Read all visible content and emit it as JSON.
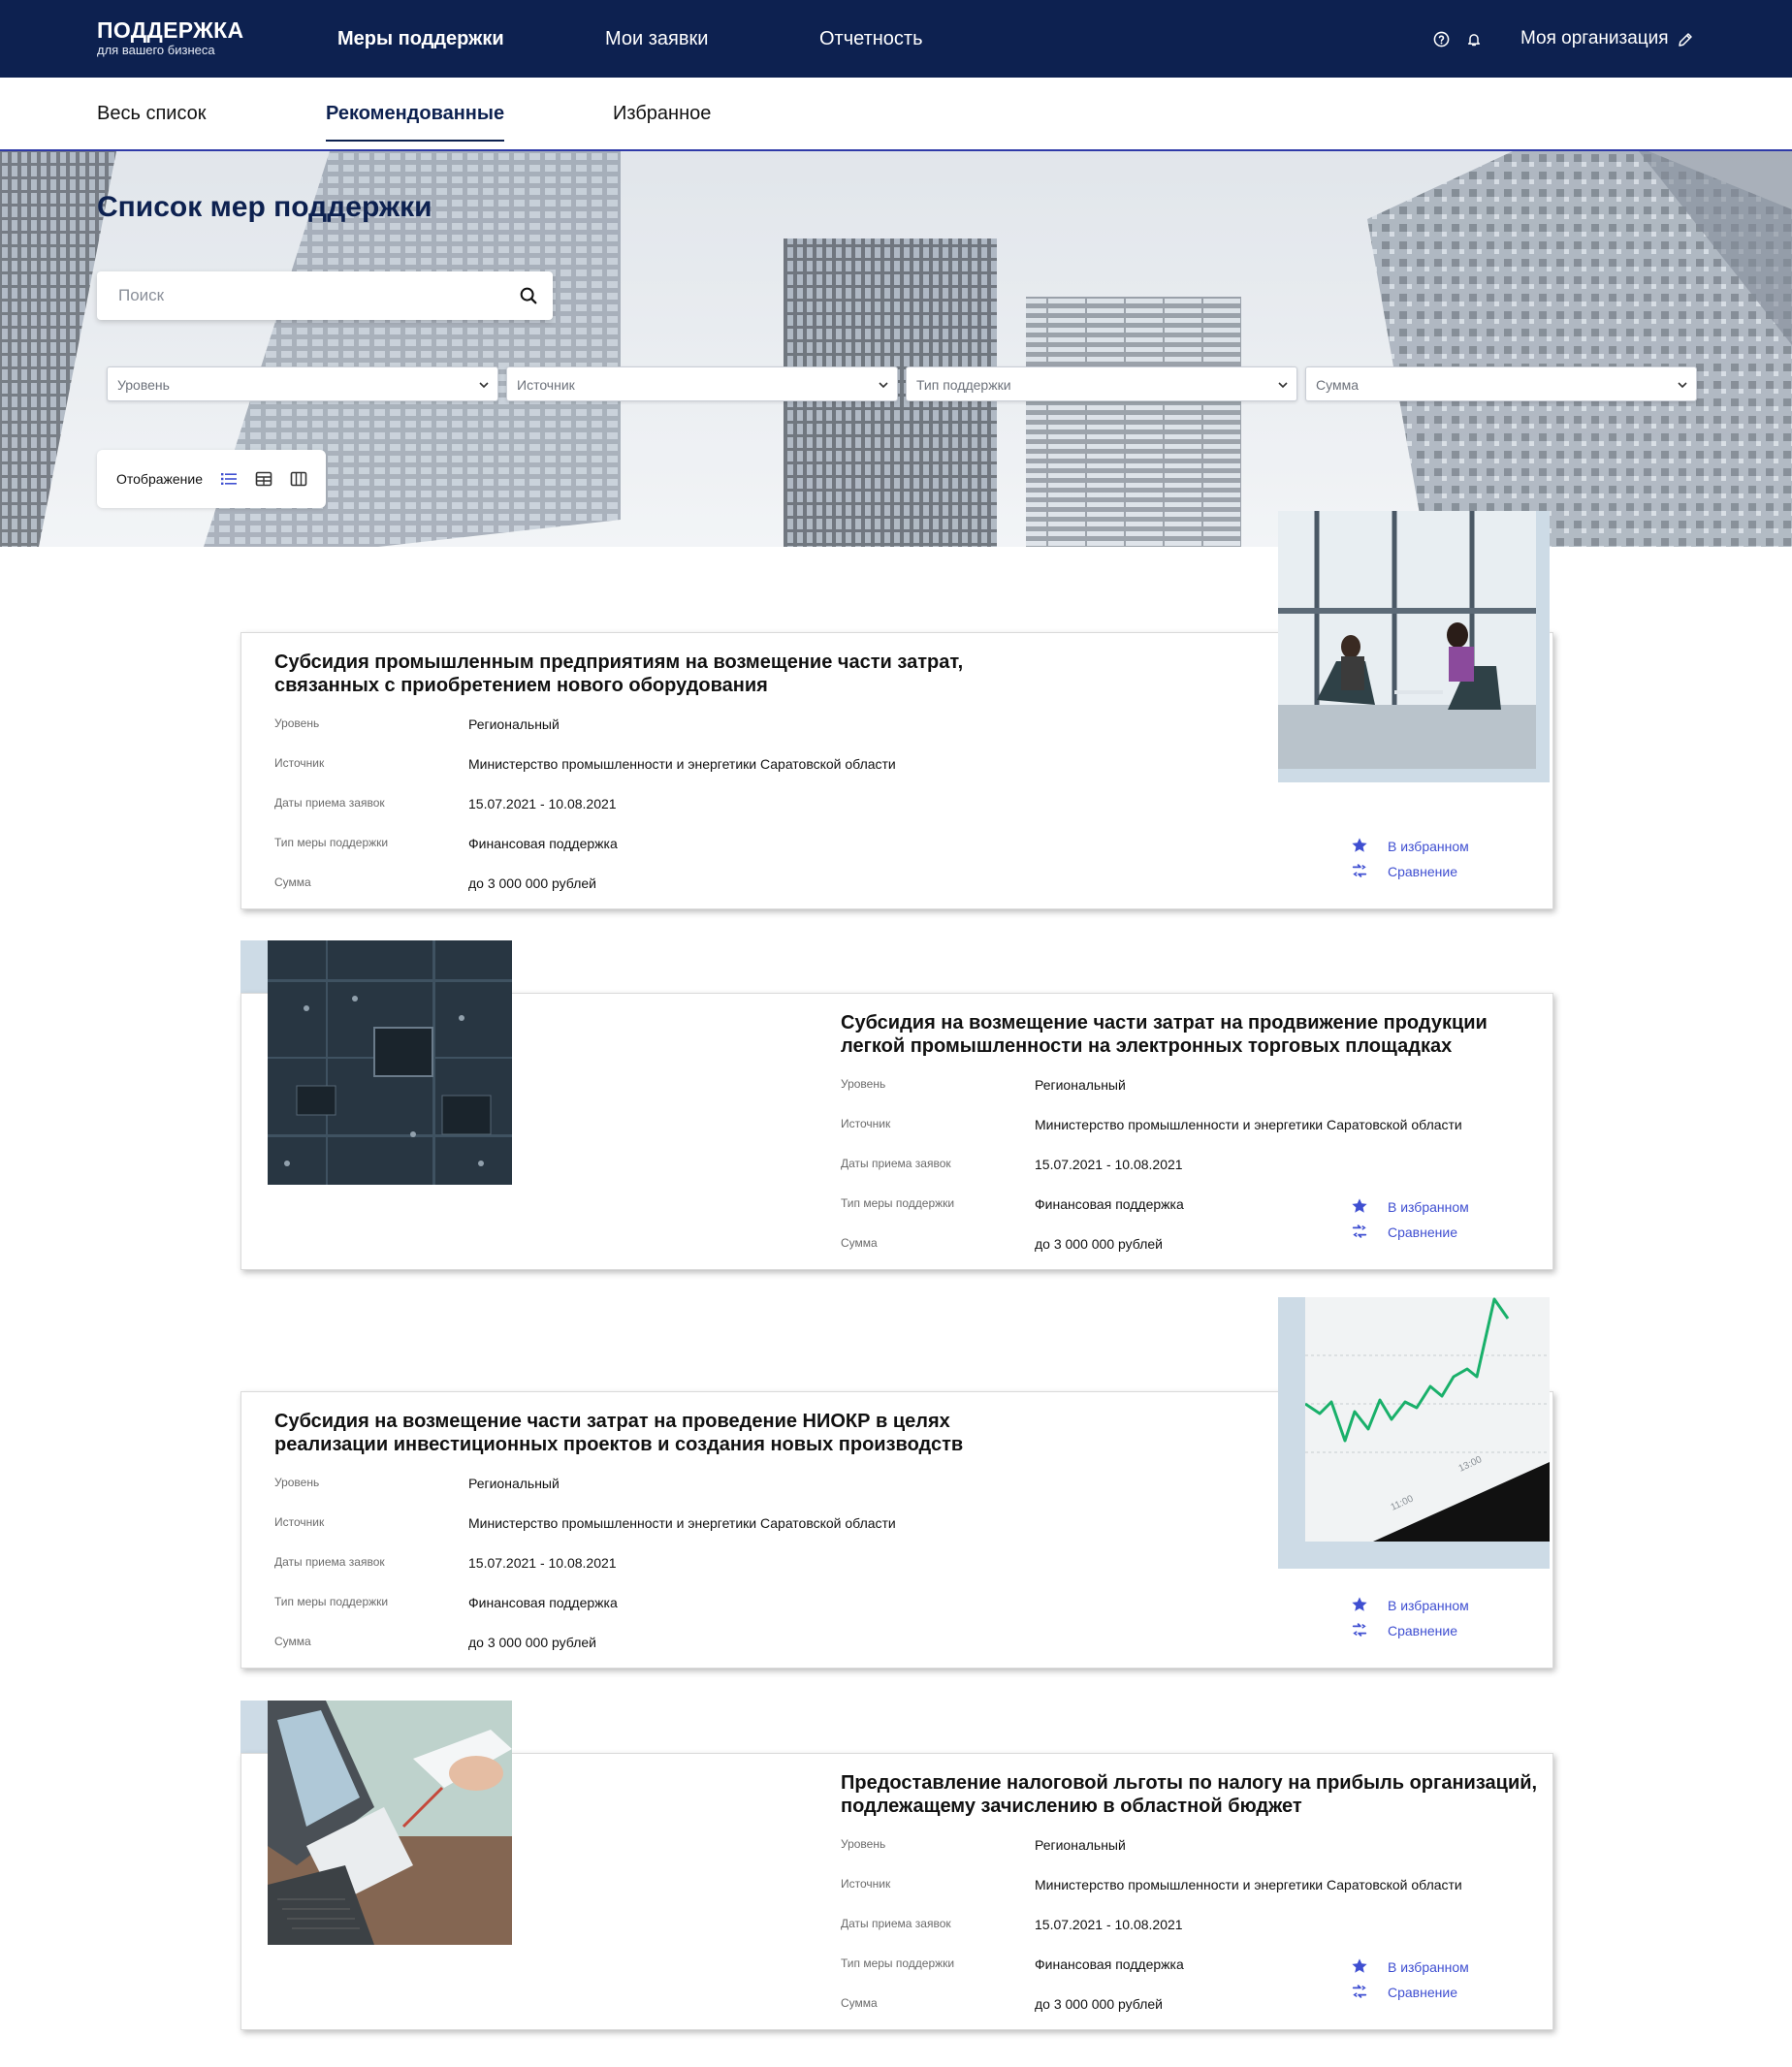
{
  "app": {
    "logo_title": "ПОДДЕРЖКА",
    "logo_subtitle": "для вашего бизнеса"
  },
  "nav": {
    "items": [
      {
        "label": "Меры поддержки",
        "active": true
      },
      {
        "label": "Мои заявки",
        "active": false
      },
      {
        "label": "Отчетность",
        "active": false
      }
    ],
    "help_icon": "question-circle-icon",
    "bell_icon": "bell-icon",
    "org_label": "Моя организация",
    "edit_icon": "pencil-icon"
  },
  "tabs": [
    {
      "label": "Весь список",
      "active": false
    },
    {
      "label": "Рекомендованные",
      "active": true
    },
    {
      "label": "Избранное",
      "active": false
    }
  ],
  "hero": {
    "title": "Список мер поддержки",
    "search_placeholder": "Поиск",
    "search_icon": "magnifier-icon",
    "filters": [
      "Уровень",
      "Источник",
      "Тип поддержки",
      "Сумма"
    ],
    "view_label": "Отображение",
    "view_icons": [
      "list-icon",
      "table-icon",
      "columns-icon"
    ],
    "active_view": "list"
  },
  "card_labels": {
    "level": "Уровень",
    "source": "Источник",
    "dates": "Даты приема заявок",
    "type": "Тип меры поддержки",
    "amount": "Сумма",
    "favorite": "В избранном",
    "compare": "Сравнение"
  },
  "cards": [
    {
      "title": "Субсидия промышленным предприятиям на возмещение части затрат, связанных с приобретением нового оборудования",
      "level": "Региональный",
      "source": "Министерство промышленности и энергетики Саратовской области",
      "dates": "15.07.2021 - 10.08.2021",
      "type": "Финансовая поддержка",
      "amount": "до 3 000 000 рублей",
      "image": "meeting-photo"
    },
    {
      "title": "Субсидия на возмещение части затрат на продвижение продукции легкой промышленности на электронных торговых площадках",
      "level": "Региональный",
      "source": "Министерство промышленности и энергетики Саратовской области",
      "dates": "15.07.2021 - 10.08.2021",
      "type": "Финансовая поддержка",
      "amount": "до 3 000 000 рублей",
      "image": "circuit-board-photo"
    },
    {
      "title": "Субсидия на возмещение части затрат на проведение НИОКР в целях реализации инвестиционных проектов и создания новых производств",
      "level": "Региональный",
      "source": "Министерство промышленности и энергетики Саратовской области",
      "dates": "15.07.2021 - 10.08.2021",
      "type": "Финансовая поддержка",
      "amount": "до 3 000 000 рублей",
      "image": "stock-chart-photo"
    },
    {
      "title": "Предоставление налоговой льготы по налогу на прибыль организаций, подлежащему зачислению в областной бюджет",
      "level": "Региональный",
      "source": "Министерство промышленности и энергетики Саратовской области",
      "dates": "15.07.2021 - 10.08.2021",
      "type": "Финансовая поддержка",
      "amount": "до 3 000 000 рублей",
      "image": "laptop-desk-photo"
    }
  ],
  "colors": {
    "nav_bg": "#0d2150",
    "accent": "#3f4fd1",
    "frame": "#cddbe6"
  }
}
